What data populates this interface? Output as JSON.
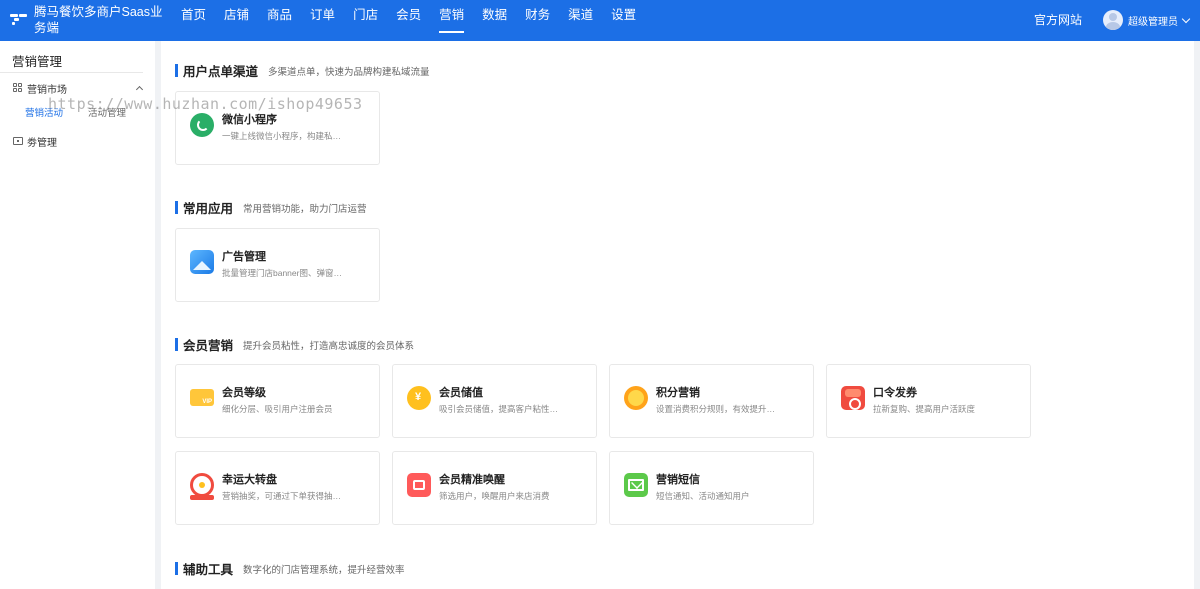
{
  "brand": {
    "title": "腾马餐饮多商户Saas业务端"
  },
  "nav": {
    "items": [
      "首页",
      "店铺",
      "商品",
      "订单",
      "门店",
      "会员",
      "营销",
      "数据",
      "财务",
      "渠道",
      "设置"
    ],
    "active": "营销"
  },
  "header": {
    "official_site": "官方网站",
    "user_name": "超级管理员"
  },
  "sidebar": {
    "title": "营销管理",
    "groups": [
      {
        "label": "营销市场",
        "icon": "grid-icon",
        "expanded": true,
        "children": [
          "营销活动",
          "活动管理"
        ],
        "active_child": "营销活动"
      },
      {
        "label": "劵管理",
        "icon": "coupon-icon"
      }
    ]
  },
  "watermark": "https://www.huzhan.com/ishop49653",
  "sections": [
    {
      "title": "用户点单渠道",
      "desc": "多渠道点单，快速为品牌构建私域流量",
      "cards": [
        {
          "title": "微信小程序",
          "desc": "一键上线微信小程序，构建私…",
          "icon": "wechat-miniprogram-icon"
        }
      ]
    },
    {
      "title": "常用应用",
      "desc": "常用营销功能，助力门店运营",
      "cards": [
        {
          "title": "广告管理",
          "desc": "批量管理门店banner图、弹窗…",
          "icon": "ad-image-icon"
        }
      ]
    },
    {
      "title": "会员营销",
      "desc": "提升会员粘性，打造高忠诚度的会员体系",
      "cards": [
        {
          "title": "会员等级",
          "desc": "细化分层、吸引用户注册会员",
          "icon": "vip-card-icon"
        },
        {
          "title": "会员储值",
          "desc": "吸引会员储值，提高客户粘性…",
          "icon": "coin-icon"
        },
        {
          "title": "积分营销",
          "desc": "设置消费积分规则，有效提升…",
          "icon": "points-icon"
        },
        {
          "title": "口令发券",
          "desc": "拉新复购、提高用户活跃度",
          "icon": "red-packet-icon"
        },
        {
          "title": "幸运大转盘",
          "desc": "营销抽奖，可通过下单获得抽…",
          "icon": "lucky-wheel-icon"
        },
        {
          "title": "会员精准唤醒",
          "desc": "筛选用户，唤醒用户来店消费",
          "icon": "wake-gift-icon"
        },
        {
          "title": "营销短信",
          "desc": "短信通知、活动通知用户",
          "icon": "sms-icon"
        }
      ]
    },
    {
      "title": "辅助工具",
      "desc": "数字化的门店管理系统，提升经营效率",
      "cards": []
    }
  ]
}
